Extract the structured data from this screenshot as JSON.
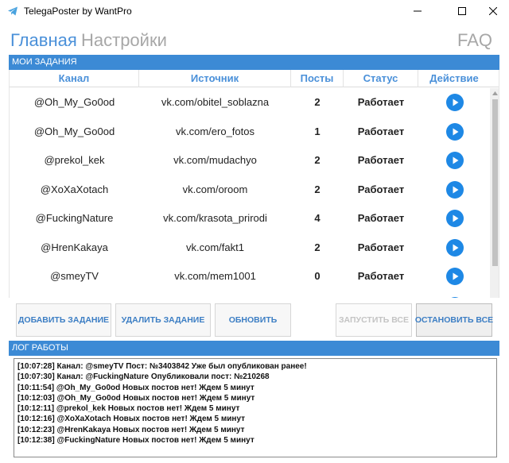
{
  "window": {
    "title": "TelegaPoster by WantPro"
  },
  "nav": {
    "main": "Главная",
    "settings": "Настройки",
    "faq": "FAQ"
  },
  "tasks": {
    "header": "МОИ ЗАДАНИЯ",
    "columns": [
      "Канал",
      "Источник",
      "Посты",
      "Статус",
      "Действие"
    ],
    "rows": [
      {
        "channel": "@Oh_My_Go0od",
        "source": "vk.com/obitel_soblazna",
        "posts": "2",
        "status": "Работает"
      },
      {
        "channel": "@Oh_My_Go0od",
        "source": "vk.com/ero_fotos",
        "posts": "1",
        "status": "Работает"
      },
      {
        "channel": "@prekol_kek",
        "source": "vk.com/mudachyo",
        "posts": "2",
        "status": "Работает"
      },
      {
        "channel": "@XoXaXotach",
        "source": "vk.com/oroom",
        "posts": "2",
        "status": "Работает"
      },
      {
        "channel": "@FuckingNature",
        "source": "vk.com/krasota_prirodi",
        "posts": "4",
        "status": "Работает"
      },
      {
        "channel": "@HrenKakaya",
        "source": "vk.com/fakt1",
        "posts": "2",
        "status": "Работает"
      },
      {
        "channel": "@smeyTV",
        "source": "vk.com/mem1001",
        "posts": "0",
        "status": "Работает"
      },
      {
        "channel": "",
        "source": "",
        "posts": "",
        "status": ""
      }
    ]
  },
  "buttons": {
    "add": "ДОБАВИТЬ ЗАДАНИЕ",
    "delete": "УДАЛИТЬ ЗАДАНИЕ",
    "refresh": "ОБНОВИТЬ",
    "start_all": "ЗАПУСТИТЬ ВСЕ",
    "stop_all": "ОСТАНОВИТЬ ВСЕ"
  },
  "log": {
    "header": "ЛОГ РАБОТЫ",
    "lines": [
      "[10:07:28] Канал: @smeyTV Пост: №3403842 Уже был опубликован ранее!",
      "[10:07:30] Канал: @FuckingNature Опубликовали пост: №210268",
      "[10:11:54] @Oh_My_Go0od Новых постов нет! Ждем 5 минут",
      "[10:12:03] @Oh_My_Go0od Новых постов нет! Ждем 5 минут",
      "[10:12:11] @prekol_kek Новых постов нет! Ждем 5 минут",
      "[10:12:16] @XoXaXotach Новых постов нет! Ждем 5 минут",
      "[10:12:23] @HrenKakaya Новых постов нет! Ждем 5 минут",
      "[10:12:38] @FuckingNature Новых постов нет! Ждем 5 минут"
    ]
  },
  "icons": {
    "app": "telegram-plane-icon",
    "action": "play-icon"
  },
  "colors": {
    "accent": "#3c8ad5",
    "nav_active": "#4a90d9",
    "nav_inactive": "#a7a7a7",
    "play": "#1e88e5"
  }
}
